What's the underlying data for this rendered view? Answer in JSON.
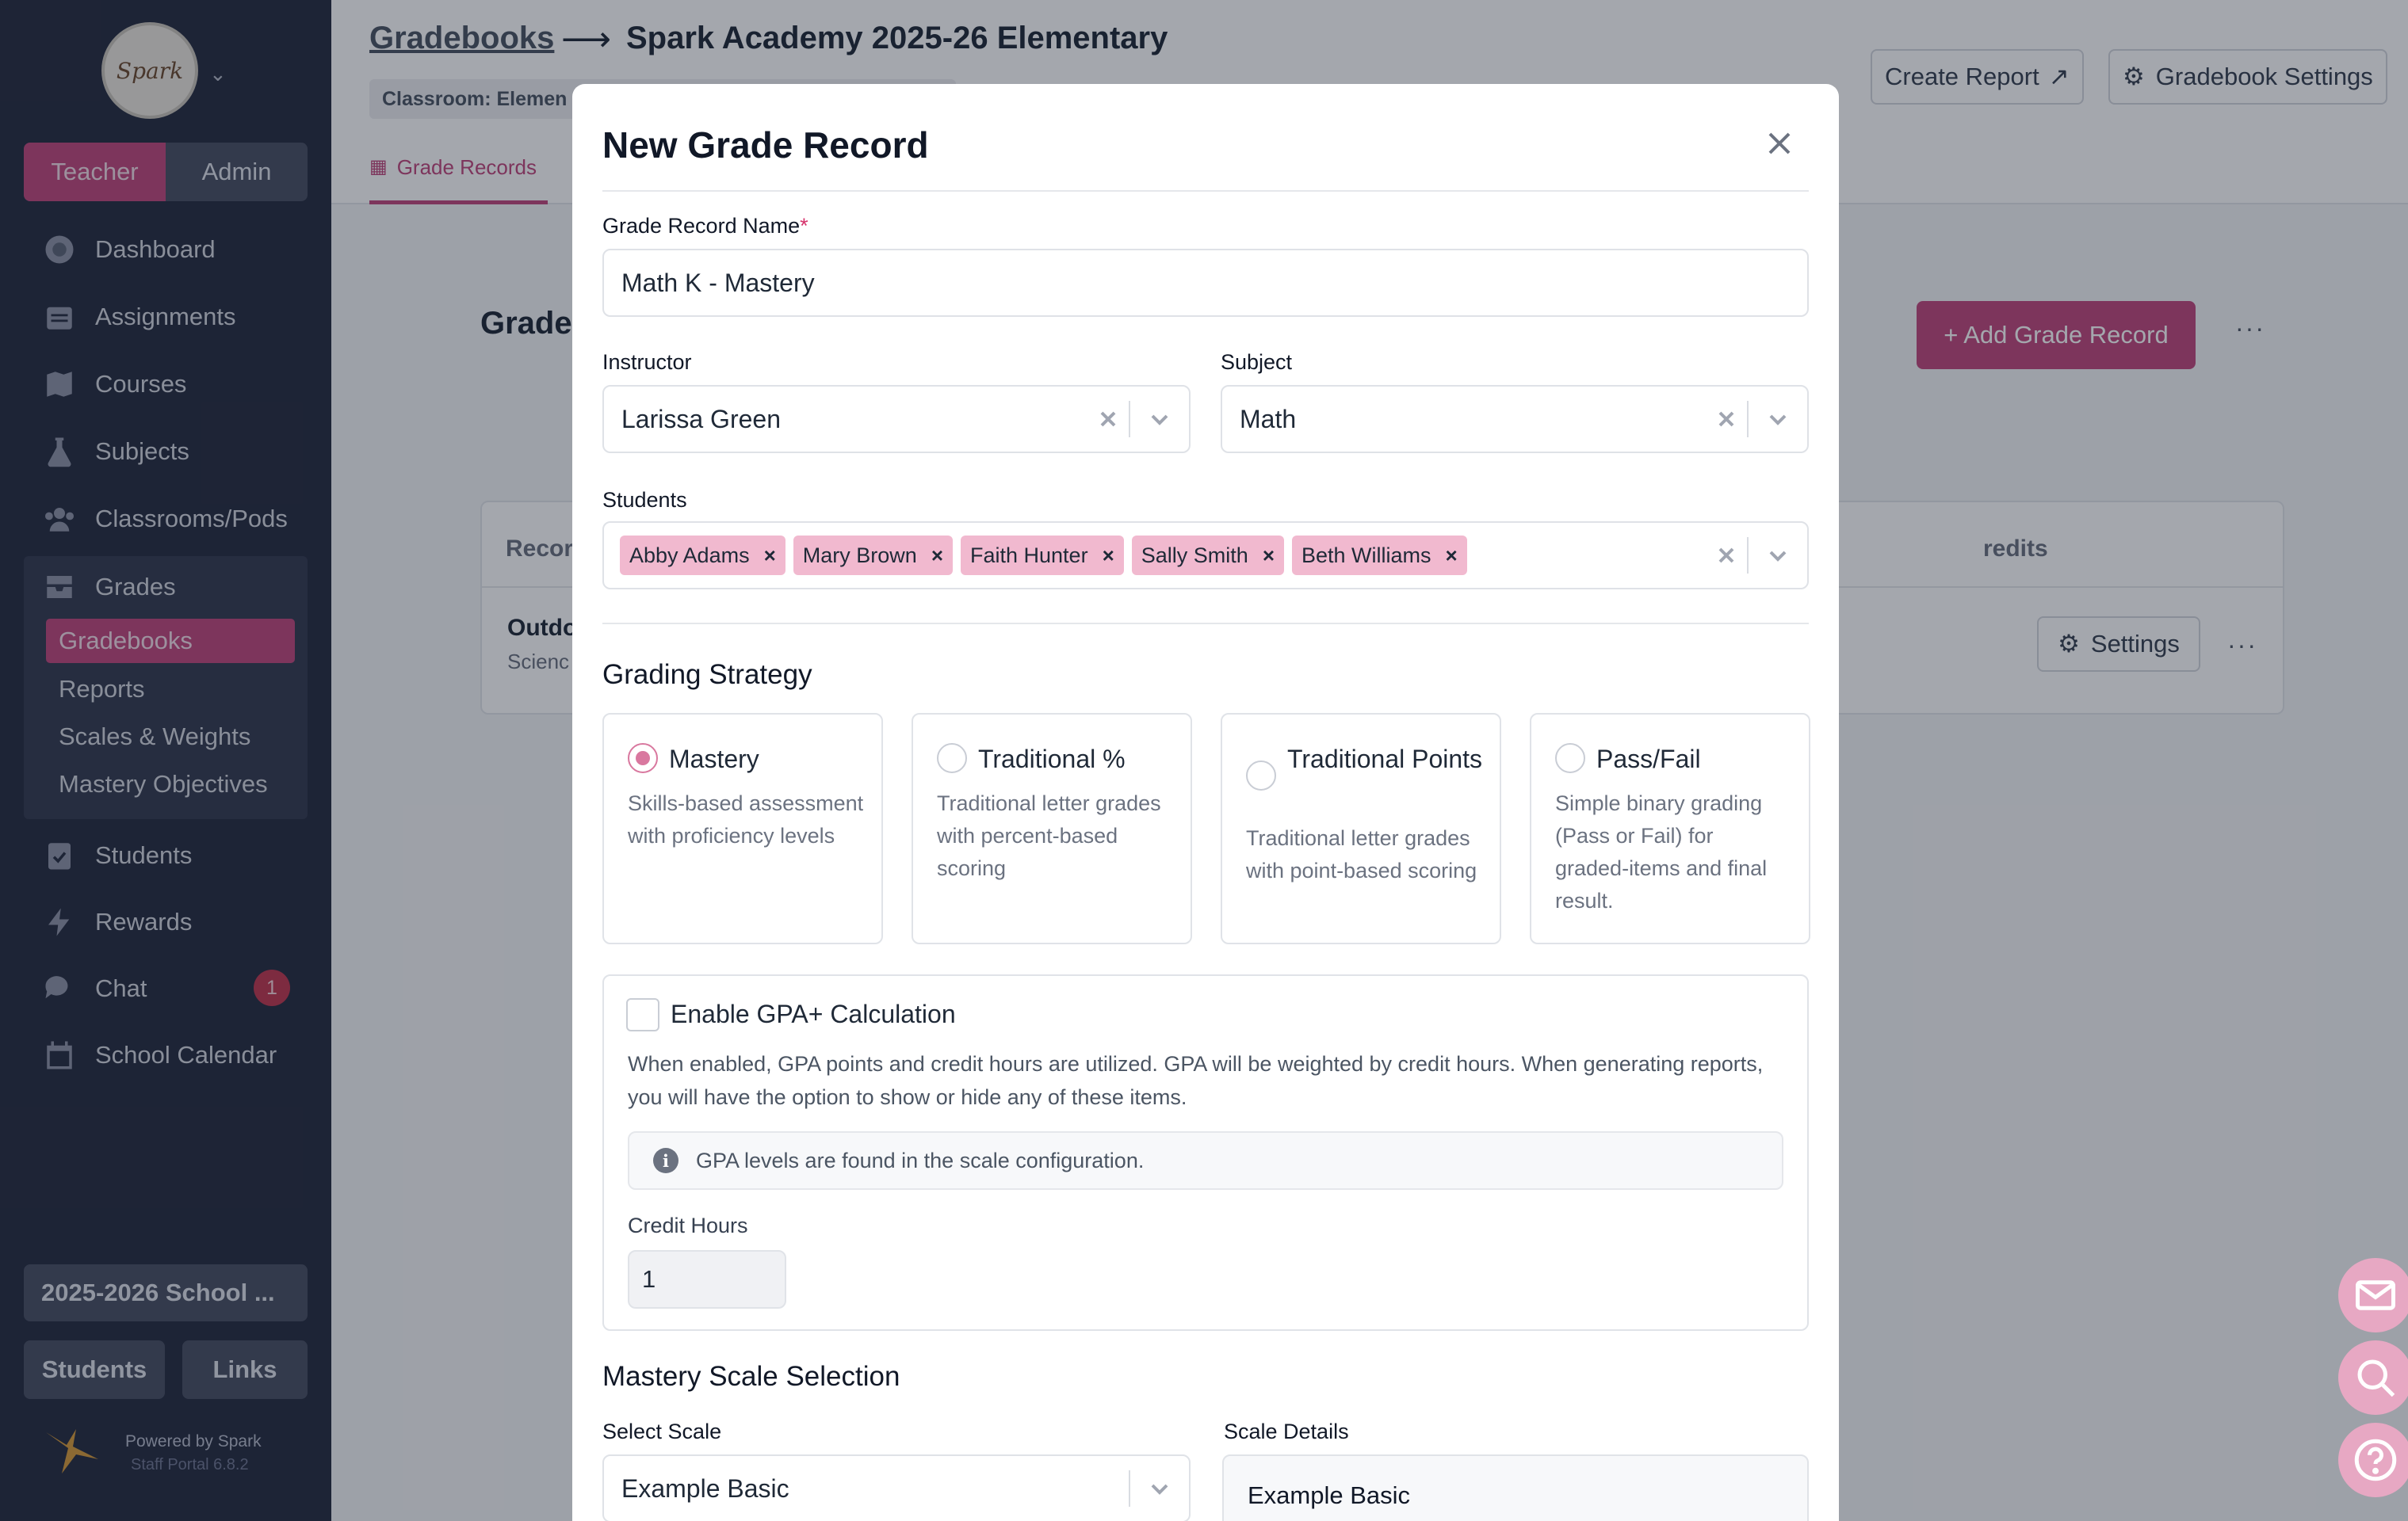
{
  "sidebar": {
    "logo_text": "Spark",
    "role_toggle": [
      "Teacher",
      "Admin"
    ],
    "nav": [
      {
        "label": "Dashboard",
        "icon": "dashboard-icon"
      },
      {
        "label": "Assignments",
        "icon": "calendar-grid-icon"
      },
      {
        "label": "Courses",
        "icon": "map-icon"
      },
      {
        "label": "Subjects",
        "icon": "flask-icon"
      },
      {
        "label": "Classrooms/Pods",
        "icon": "users-icon"
      },
      {
        "label": "Grades",
        "icon": "inbox-tray-icon"
      },
      {
        "label": "Students",
        "icon": "clipboard-check-icon"
      },
      {
        "label": "Rewards",
        "icon": "bolt-icon"
      },
      {
        "label": "Chat",
        "icon": "chat-bubbles-icon"
      },
      {
        "label": "School Calendar",
        "icon": "calendar-icon"
      }
    ],
    "grades_sub": [
      "Gradebooks",
      "Reports",
      "Scales & Weights",
      "Mastery Objectives"
    ],
    "chat_badge": "1",
    "school_year": "2025-2026 School ...",
    "bottom_buttons": [
      "Students",
      "Links"
    ],
    "powered_by": "Powered by Spark",
    "portal_version": "Staff Portal 6.8.2"
  },
  "header": {
    "breadcrumb_link": "Gradebooks",
    "breadcrumb_arrow": "⟶",
    "title": "Spark Academy 2025-26 Elementary",
    "classroom_chip": "Classroom: Elemen",
    "tab": "Grade Records",
    "create_report": "Create Report",
    "gradebook_settings": "Gradebook Settings"
  },
  "page": {
    "section_title": "Grade",
    "add_button": "+ Add Grade Record",
    "more": "···",
    "col_record": "Recor",
    "col_credits": "redits",
    "row_title": "Outdo",
    "row_sub": "Scienc",
    "settings_button": "Settings"
  },
  "modal": {
    "title": "New Grade Record",
    "name_label": "Grade Record Name",
    "name_required": "*",
    "name_value": "Math K - Mastery",
    "instructor_label": "Instructor",
    "instructor_value": "Larissa Green",
    "subject_label": "Subject",
    "subject_value": "Math",
    "students_label": "Students",
    "students": [
      "Abby Adams",
      "Mary Brown",
      "Faith Hunter",
      "Sally Smith",
      "Beth Williams"
    ],
    "tag_remove": "×",
    "strategy_heading": "Grading Strategy",
    "strategies": [
      {
        "title": "Mastery",
        "desc": "Skills-based assessment with proficiency levels",
        "selected": true
      },
      {
        "title": "Traditional %",
        "desc": "Traditional letter grades with percent-based scoring",
        "selected": false
      },
      {
        "title": "Traditional Points",
        "desc": "Traditional letter grades with point-based scoring",
        "selected": false
      },
      {
        "title": "Pass/Fail",
        "desc": "Simple binary grading (Pass or Fail) for graded-items and final result.",
        "selected": false
      }
    ],
    "gpa_title": "Enable GPA+ Calculation",
    "gpa_enabled": false,
    "gpa_desc": "When enabled, GPA points and credit hours are utilized. GPA will be weighted by credit hours. When generating reports, you will have the option to show or hide any of these items.",
    "gpa_info": "GPA levels are found in the scale configuration.",
    "credit_hours_label": "Credit Hours",
    "credit_hours_value": "1",
    "mastery_heading": "Mastery Scale Selection",
    "select_scale_label": "Select Scale",
    "select_scale_value": "Example Basic",
    "scale_details_label": "Scale Details",
    "scale_details_value": "Example Basic"
  },
  "colors": {
    "accent": "#c0487d",
    "sidebar_bg": "#262c40",
    "tag_bg": "#f1b9cf",
    "radio_on": "#d9789f"
  }
}
